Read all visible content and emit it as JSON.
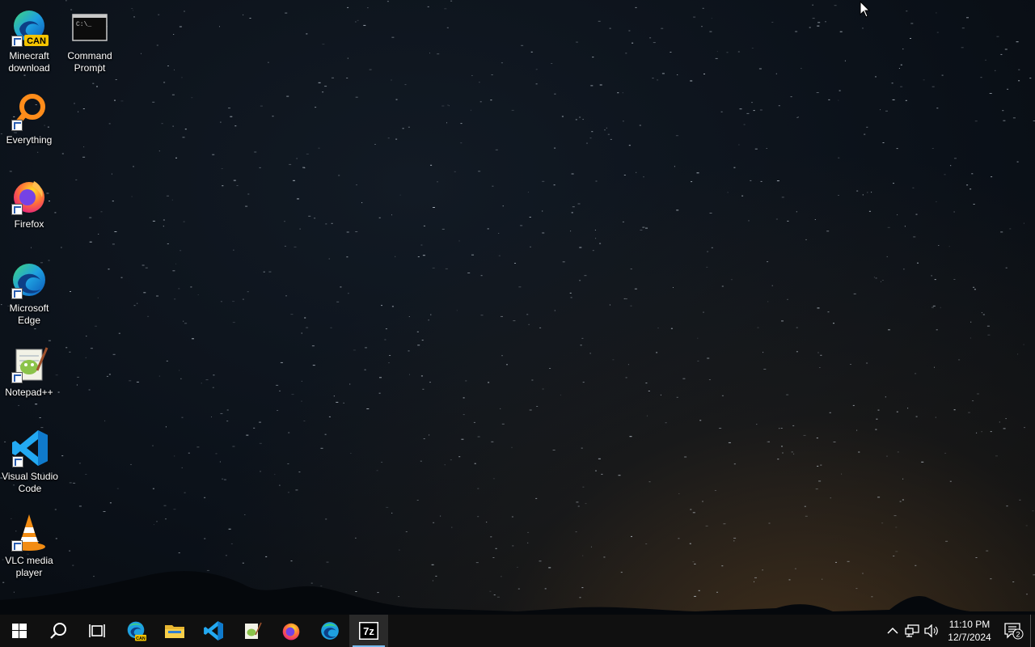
{
  "desktop_icons": [
    {
      "label": "Minecraft download",
      "icon": "edge-can-icon"
    },
    {
      "label": "Command Prompt",
      "icon": "cmd-icon"
    },
    {
      "label": "Everything",
      "icon": "everything-search-icon"
    },
    {
      "label": "Firefox",
      "icon": "firefox-icon"
    },
    {
      "label": "Microsoft Edge",
      "icon": "edge-icon"
    },
    {
      "label": "Notepad++",
      "icon": "notepadpp-icon"
    },
    {
      "label": "Visual Studio Code",
      "icon": "vscode-icon"
    },
    {
      "label": "VLC media player",
      "icon": "vlc-icon"
    }
  ],
  "icon_badges": {
    "can": "CAN",
    "cmd_prompt_text": "C:\\_",
    "seven_zip": "7z"
  },
  "taskbar": {
    "pinned": [
      "start-icon",
      "search-icon",
      "task-view-icon",
      "edge-can-icon",
      "file-explorer-icon",
      "vscode-icon",
      "notepadpp-icon",
      "firefox-icon",
      "edge-icon",
      "seven-zip-icon"
    ],
    "active": "seven-zip-icon"
  },
  "tray": {
    "time": "11:10 PM",
    "date": "12/7/2024",
    "notification_count": "2"
  },
  "colors": {
    "taskbar_bg": "#101010",
    "active_indicator": "#76b9ed",
    "vscode_blue": "#23a9f2",
    "firefox_orange": "#ff7139",
    "vlc_orange": "#f28c13"
  }
}
